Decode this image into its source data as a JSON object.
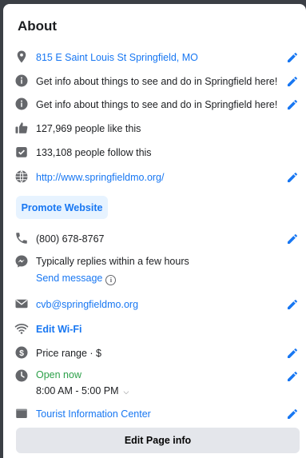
{
  "section_title": "About",
  "rows": {
    "address": "815 E Saint Louis St Springfield, MO",
    "info1": "Get info about things to see and do in Springfield here!",
    "info2": "Get info about things to see and do in Springfield here!",
    "likes": "127,969 people like this",
    "follows": "133,108 people follow this",
    "website": "http://www.springfieldmo.org/",
    "promote_label": "Promote Website",
    "phone": "(800) 678-8767",
    "replies": "Typically replies within a few hours",
    "send_message": "Send message",
    "email": "cvb@springfieldmo.org",
    "wifi": "Edit Wi-Fi",
    "price": "Price range · $",
    "open_status": "Open now",
    "hours": "8:00 AM - 5:00 PM",
    "category": "Tourist Information Center"
  },
  "edit_page_label": "Edit Page info",
  "icons": {
    "location": "location-pin-icon",
    "info": "info-icon",
    "like": "thumbs-up-icon",
    "follow": "follow-check-icon",
    "globe": "globe-icon",
    "phone": "phone-icon",
    "messenger": "messenger-icon",
    "email": "envelope-icon",
    "wifi": "wifi-icon",
    "price": "dollar-icon",
    "clock": "clock-icon",
    "category": "flag-icon",
    "edit": "pencil-icon"
  },
  "colors": {
    "link": "#1877f2",
    "open_green": "#2ca049",
    "icon_gray": "#65676b",
    "promote_bg": "#e7f3ff",
    "button_bg": "#e4e6eb"
  }
}
